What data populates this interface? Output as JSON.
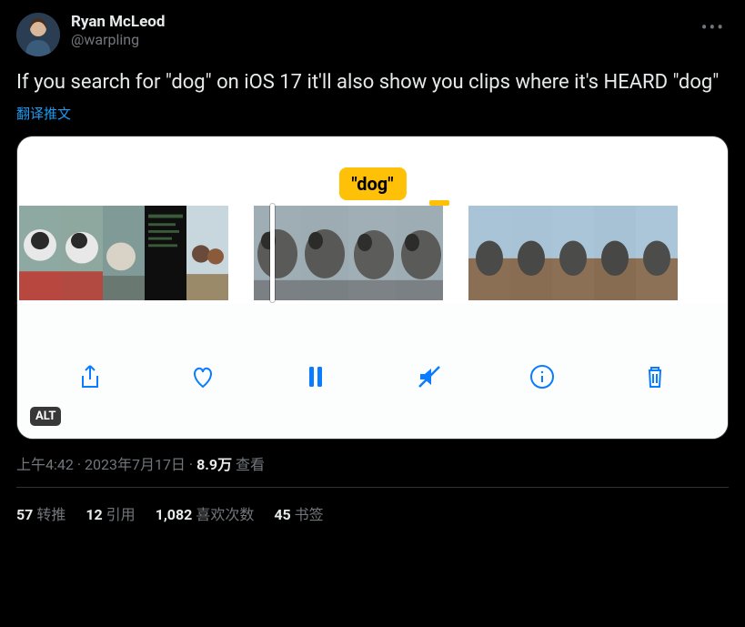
{
  "author": {
    "display_name": "Ryan McLeod",
    "handle": "@warpling"
  },
  "tweet_text": "If you search for \"dog\" on iOS 17 it'll also show you clips where it's HEARD \"dog\"",
  "translate_label": "翻译推文",
  "media": {
    "search_label": "\"dog\"",
    "alt_badge": "ALT",
    "toolbar": {
      "share": "Share",
      "like": "Like",
      "pause": "Pause",
      "mute": "Mute",
      "info": "Info",
      "delete": "Delete"
    }
  },
  "meta": {
    "time": "上午4:42",
    "dot": " · ",
    "date": "2023年7月17日",
    "views_count": "8.9万",
    "views_label": " 查看"
  },
  "stats": {
    "retweets_count": "57",
    "retweets_label": " 转推",
    "quotes_count": "12",
    "quotes_label": " 引用",
    "likes_count": "1,082",
    "likes_label": " 喜欢次数",
    "bookmarks_count": "45",
    "bookmarks_label": " 书签"
  }
}
